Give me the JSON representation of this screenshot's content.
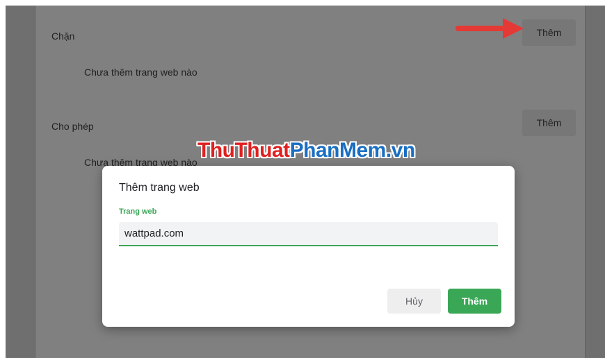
{
  "blocked": {
    "title": "Chặn",
    "empty_text": "Chưa thêm trang web nào",
    "add_label": "Thêm"
  },
  "allowed": {
    "title": "Cho phép",
    "empty_text": "Chưa thêm trang web nào",
    "add_label": "Thêm"
  },
  "watermark": {
    "part1": "ThuThuat",
    "part2": "PhanMem.vn"
  },
  "dialog": {
    "title": "Thêm trang web",
    "field_label": "Trang web",
    "field_value": "wattpad.com",
    "cancel_label": "Hủy",
    "add_label": "Thêm"
  },
  "colors": {
    "accent": "#3aa757",
    "arrow": "#e53935"
  }
}
